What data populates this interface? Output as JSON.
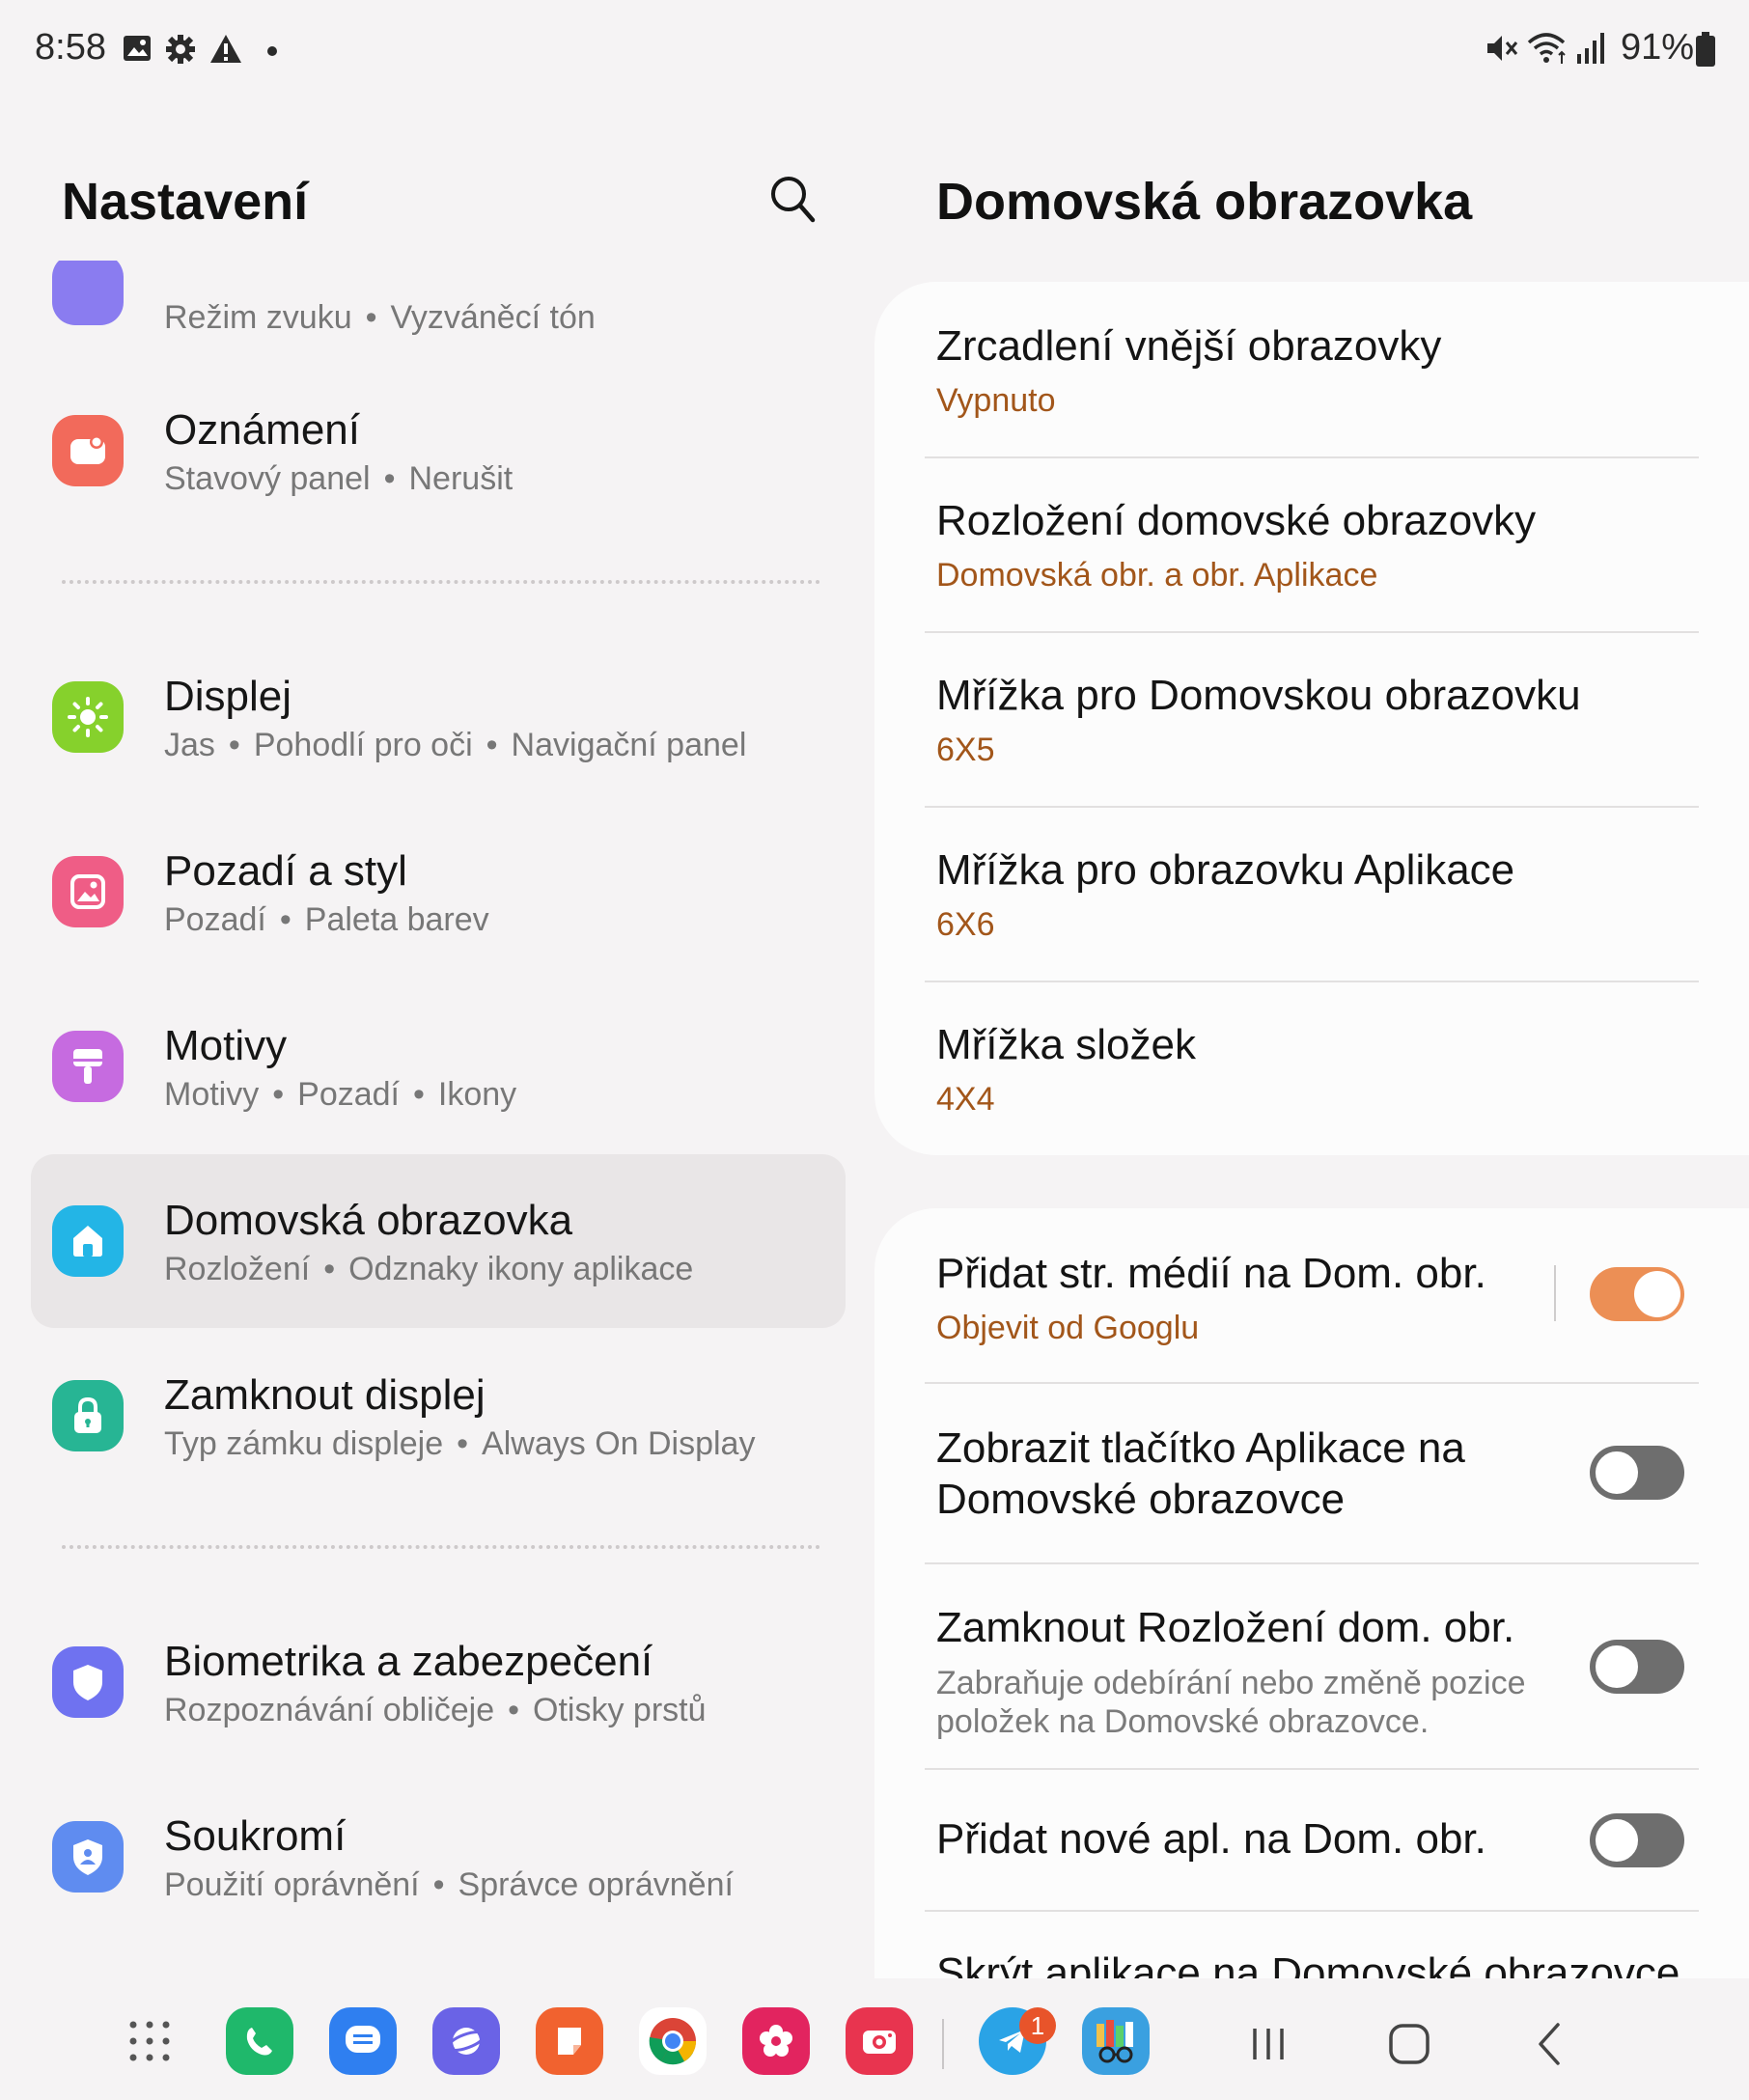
{
  "status_bar": {
    "time": "8:58",
    "battery_percent": "91%",
    "left_icons": [
      "image-icon",
      "gear-icon",
      "warning-icon",
      "dot-icon"
    ],
    "right_icons": [
      "mute-icon",
      "wifi-icon",
      "signal-icon",
      "battery-icon"
    ]
  },
  "left_pane": {
    "title": "Nastavení",
    "search_icon": "search-icon",
    "items": [
      {
        "title": "",
        "subtitle": [
          "Režim zvuku",
          "Vyzváněcí tón"
        ],
        "icon": "sound-icon",
        "color": "#8a7cf0"
      },
      {
        "title": "Oznámení",
        "subtitle": [
          "Stavový panel",
          "Nerušit"
        ],
        "icon": "notification-icon",
        "color": "#f26a5b"
      },
      {
        "title": "Displej",
        "subtitle": [
          "Jas",
          "Pohodlí pro oči",
          "Navigační panel"
        ],
        "icon": "sun-icon",
        "color": "#86d12c"
      },
      {
        "title": "Pozadí a styl",
        "subtitle": [
          "Pozadí",
          "Paleta barev"
        ],
        "icon": "wallpaper-icon",
        "color": "#ef5d86"
      },
      {
        "title": "Motivy",
        "subtitle": [
          "Motivy",
          "Pozadí",
          "Ikony"
        ],
        "icon": "brush-icon",
        "color": "#c66be0"
      },
      {
        "title": "Domovská obrazovka",
        "subtitle": [
          "Rozložení",
          "Odznaky ikony aplikace"
        ],
        "icon": "home-icon",
        "color": "#23b5e6",
        "active": true
      },
      {
        "title": "Zamknout displej",
        "subtitle": [
          "Typ zámku displeje",
          "Always On Display"
        ],
        "icon": "lock-icon",
        "color": "#27b594"
      },
      {
        "title": "Biometrika a zabezpečení",
        "subtitle": [
          "Rozpoznávání obličeje",
          "Otisky prstů"
        ],
        "icon": "shield-icon",
        "color": "#6f72f0"
      },
      {
        "title": "Soukromí",
        "subtitle": [
          "Použití oprávnění",
          "Správce oprávnění"
        ],
        "icon": "privacy-icon",
        "color": "#5f8cf0"
      }
    ]
  },
  "right_pane": {
    "title": "Domovská obrazovka",
    "card1": [
      {
        "title": "Zrcadlení vnější obrazovky",
        "value": "Vypnuto"
      },
      {
        "title": "Rozložení domovské obrazovky",
        "value": "Domovská obr. a obr. Aplikace"
      },
      {
        "title": "Mřížka pro Domovskou obrazovku",
        "value": "6X5"
      },
      {
        "title": "Mřížka pro obrazovku Aplikace",
        "value": "6X6"
      },
      {
        "title": "Mřížka složek",
        "value": "4X4"
      }
    ],
    "card2": [
      {
        "title": "Přidat str. médií na Dom. obr.",
        "value": "Objevit od Googlu",
        "toggle": true
      },
      {
        "title_line1": "Zobrazit tlačítko Aplikace na",
        "title_line2": "Domovské obrazovce",
        "toggle": false
      },
      {
        "title": "Zamknout Rozložení dom. obr.",
        "description_line1": "Zabraňuje odebírání nebo změně pozice",
        "description_line2": "položek na Domovské obrazovce.",
        "toggle": false
      },
      {
        "title": "Přidat nové apl. na Dom. obr.",
        "toggle": false
      },
      {
        "title": "Skrýt aplikace na Domovské obrazovce"
      }
    ]
  },
  "dock": {
    "apps": [
      {
        "name": "app-drawer-icon",
        "color": ""
      },
      {
        "name": "phone-app-icon",
        "color": "#1fb86b"
      },
      {
        "name": "messages-app-icon",
        "color": "#2f7ff0"
      },
      {
        "name": "internet-app-icon",
        "color": "#6a63e6"
      },
      {
        "name": "notes-app-icon",
        "color": "#f1622f"
      },
      {
        "name": "chrome-app-icon",
        "color": "#ffffff"
      },
      {
        "name": "gallery-app-icon",
        "color": "#e2245f"
      },
      {
        "name": "camera-app-icon",
        "color": "#e8344f"
      },
      {
        "name": "telegram-app-icon",
        "color": "#2aa3e6"
      },
      {
        "name": "bookshelf-app-icon",
        "color": "#3aa0e0"
      }
    ],
    "badge": "1",
    "nav": [
      "recents-icon",
      "home-nav-icon",
      "back-icon"
    ]
  },
  "colors": {
    "accent": "#ec8f55",
    "value_text": "#a2561a",
    "background": "#f5f3f4",
    "card": "#fcfcfc"
  }
}
